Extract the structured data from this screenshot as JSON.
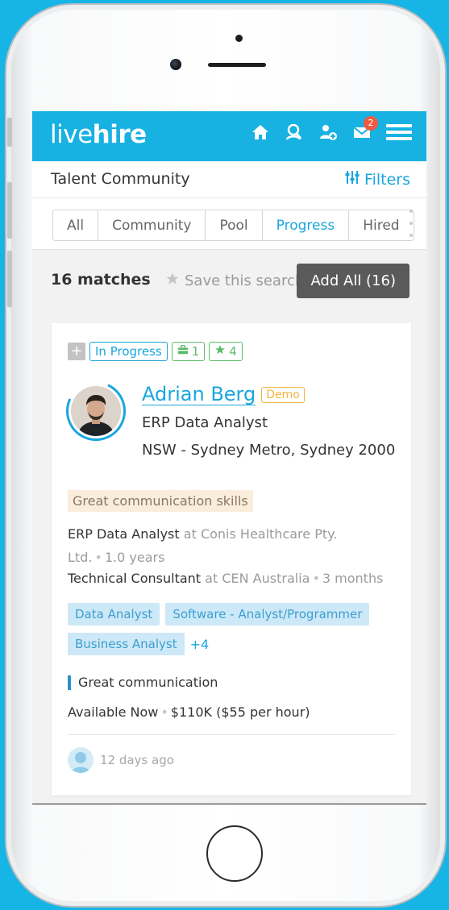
{
  "app": {
    "logo_light": "live",
    "logo_bold": "hire",
    "messages_count": "2"
  },
  "header": {
    "title": "Talent Community",
    "filters_label": "Filters"
  },
  "tabs": [
    {
      "label": "All"
    },
    {
      "label": "Community"
    },
    {
      "label": "Pool"
    },
    {
      "label": "Progress"
    },
    {
      "label": "Hired"
    }
  ],
  "active_tab": "Progress",
  "list": {
    "matches": "16 matches",
    "save_search": "Save this search",
    "add_all": "Add All (16)"
  },
  "candidate": {
    "status": "In Progress",
    "jobs_count": "1",
    "rating": "4",
    "name": "Adrian Berg",
    "demo_label": "Demo",
    "title": "ERP Data Analyst",
    "location": "NSW - Sydney Metro, Sydney 2000",
    "highlight": "Great communication skills",
    "experience": [
      {
        "role": "ERP Data Analyst",
        "at": "at",
        "company": "Conis Healthcare Pty. Ltd.",
        "duration": "1.0 years"
      },
      {
        "role": "Technical Consultant",
        "at": "at",
        "company": "CEN Australia",
        "duration": "3 months"
      }
    ],
    "tags": [
      "Data Analyst",
      "Software - Analyst/Programmer",
      "Business Analyst"
    ],
    "more_tags": "+4",
    "skill": "Great communication",
    "availability": "Available Now",
    "salary": "$110K ($55 per hour)",
    "updated": "12 days ago"
  },
  "colors": {
    "brand": "#17b1e2",
    "accent": "#1aa6de",
    "badge": "#ef5b42",
    "demo": "#f2b440",
    "green": "#5cbd6a"
  },
  "icons": [
    "home-icon",
    "search-people-icon",
    "add-user-icon",
    "mail-icon",
    "menu-icon",
    "filters-icon",
    "star-icon",
    "briefcase-icon",
    "user-avatar-icon"
  ]
}
